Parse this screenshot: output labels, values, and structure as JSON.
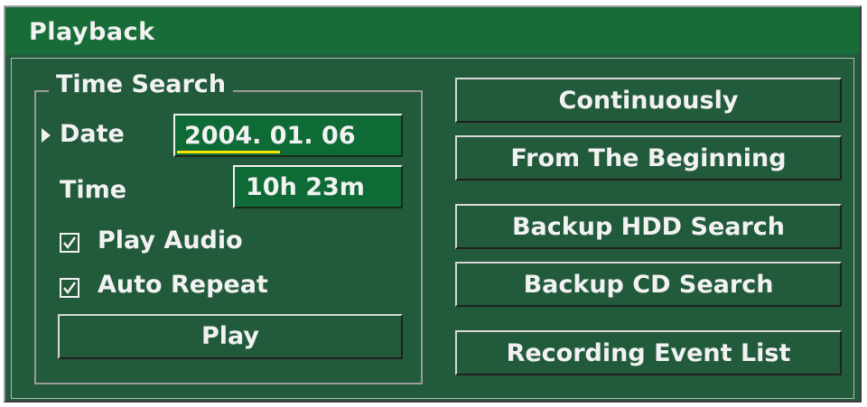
{
  "window": {
    "title": "Playback"
  },
  "time_search": {
    "legend": "Time Search",
    "date_label": "Date",
    "date_value": "2004. 01. 06",
    "time_label": "Time",
    "time_value": "10h 23m",
    "play_audio_label": "Play Audio",
    "play_audio_checked": true,
    "auto_repeat_label": "Auto Repeat",
    "auto_repeat_checked": true,
    "play_label": "Play"
  },
  "actions": {
    "continuously": "Continuously",
    "from_beginning": "From The Beginning",
    "backup_hdd_search": "Backup HDD Search",
    "backup_cd_search": "Backup CD Search",
    "recording_event_list": "Recording Event List"
  },
  "colors": {
    "panel": "#225a3c",
    "titlebar": "#186c38",
    "field": "#0f6b35",
    "cursor_underline": "#ffe600"
  }
}
